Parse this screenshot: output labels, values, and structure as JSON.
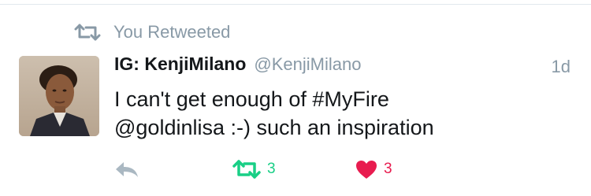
{
  "retweet_context": {
    "icon": "retweet-icon",
    "text": "You Retweeted"
  },
  "tweet": {
    "avatar": "user-avatar",
    "display_name": "IG: KenjiMilano",
    "handle": "@KenjiMilano",
    "timestamp": "1d",
    "text_lines": [
      "I can't get enough of #MyFire",
      "@goldinlisa :-) such an inspiration"
    ]
  },
  "actions": {
    "reply": {
      "icon": "reply-icon"
    },
    "retweet": {
      "icon": "retweet-icon",
      "count": "3",
      "active": true,
      "color": "#19cf86"
    },
    "like": {
      "icon": "heart-icon",
      "count": "3",
      "active": true,
      "color": "#e81c4f"
    }
  },
  "colors": {
    "muted": "#8899a6",
    "text": "#14171a",
    "divider": "#e1e8ed"
  }
}
